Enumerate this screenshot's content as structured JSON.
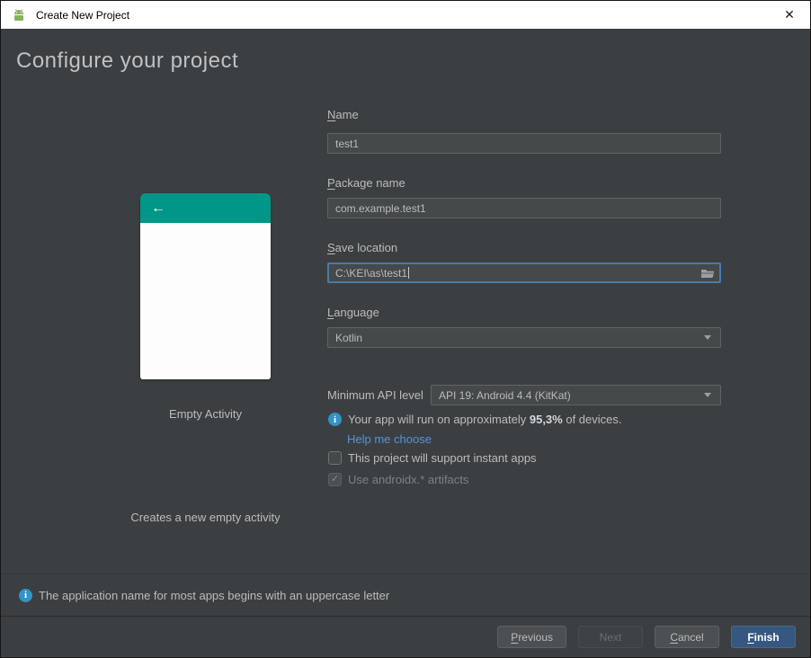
{
  "window": {
    "title": "Create New Project",
    "close_glyph": "✕"
  },
  "header": {
    "title": "Configure your project"
  },
  "template_preview": {
    "back_arrow": "←",
    "accent_color": "#009688",
    "name": "Empty Activity",
    "description": "Creates a new empty activity"
  },
  "form": {
    "name": {
      "label_mnemonic": "N",
      "label_rest": "ame",
      "value": "test1"
    },
    "package": {
      "label_mnemonic": "P",
      "label_rest": "ackage name",
      "value": "com.example.test1"
    },
    "save_location": {
      "label_mnemonic": "S",
      "label_rest": "ave location",
      "value": "C:\\KEI\\as\\test1"
    },
    "language": {
      "label_mnemonic": "L",
      "label_rest": "anguage",
      "value": "Kotlin"
    },
    "min_api": {
      "label": "Minimum API level",
      "value": "API 19: Android 4.4 (KitKat)"
    },
    "api_note": {
      "pre": "Your app will run on approximately ",
      "bold": "95,3%",
      "post": " of devices."
    },
    "help_link": "Help me choose",
    "instant_apps": {
      "label": "This project will support instant apps",
      "checked": false
    },
    "androidx": {
      "label": "Use androidx.* artifacts",
      "checked": true,
      "check_glyph": "✓"
    }
  },
  "footer": {
    "hint": "The application name for most apps begins with an uppercase letter",
    "info_glyph": "i",
    "buttons": {
      "previous": {
        "mnemonic": "P",
        "rest": "revious"
      },
      "next": {
        "label": "Next"
      },
      "cancel": {
        "mnemonic": "C",
        "rest": "ancel"
      },
      "finish": {
        "mnemonic": "F",
        "rest": "inish"
      }
    }
  }
}
